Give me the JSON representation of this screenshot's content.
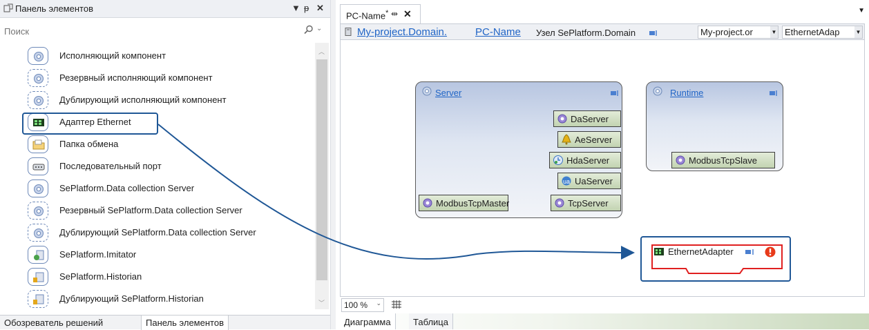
{
  "toolbox": {
    "title": "Панель элементов",
    "search_placeholder": "Поиск",
    "items": [
      {
        "label": "Исполняющий компонент",
        "icon": "gear-icon",
        "dashed": false
      },
      {
        "label": "Резервный исполняющий компонент",
        "icon": "gear-icon",
        "dashed": true
      },
      {
        "label": "Дублирующий исполняющий компонент",
        "icon": "gear-icon",
        "dashed": true
      },
      {
        "label": "Адаптер Ethernet",
        "icon": "network-card-icon",
        "dashed": false
      },
      {
        "label": "Папка обмена",
        "icon": "folder-icon",
        "dashed": false
      },
      {
        "label": "Последовательный порт",
        "icon": "serial-port-icon",
        "dashed": false
      },
      {
        "label": "SePlatform.Data collection Server",
        "icon": "gear-icon",
        "dashed": false
      },
      {
        "label": "Резервный SePlatform.Data collection Server",
        "icon": "gear-icon",
        "dashed": true
      },
      {
        "label": "Дублирующий SePlatform.Data collection Server",
        "icon": "gear-icon",
        "dashed": true
      },
      {
        "label": "SePlatform.Imitator",
        "icon": "imitator-icon",
        "dashed": false
      },
      {
        "label": "SePlatform.Historian",
        "icon": "database-icon",
        "dashed": false
      },
      {
        "label": "Дублирующий SePlatform.Historian",
        "icon": "database-icon",
        "dashed": true
      }
    ],
    "tabs": {
      "solution_explorer": "Обозреватель решений",
      "toolbox": "Панель элементов"
    }
  },
  "document": {
    "tab_label": "PC-Name",
    "tab_modified": "*",
    "breadcrumb": {
      "part1": "My-project.Domain.",
      "part2": "PC-Name",
      "node_label": "Узел SePlatform.Domain"
    },
    "project_combo": "My-project.or",
    "adapter_combo": "EthernetAdap",
    "zoom": "100 %",
    "bottom_tabs": {
      "diagram": "Диаграмма",
      "table": "Таблица"
    }
  },
  "diagram": {
    "server": {
      "title": "Server",
      "chips": [
        "DaServer",
        "AeServer",
        "HdaServer",
        "UaServer",
        "TcpServer"
      ],
      "left_chip": "ModbusTcpMaster"
    },
    "runtime": {
      "title": "Runtime",
      "chip": "ModbusTcpSlave"
    },
    "ethernet_adapter": {
      "label": "EthernetAdapter",
      "status": "error"
    }
  },
  "colors": {
    "accent": "#1f5796",
    "link": "#1f64c6",
    "error": "#e02020"
  }
}
